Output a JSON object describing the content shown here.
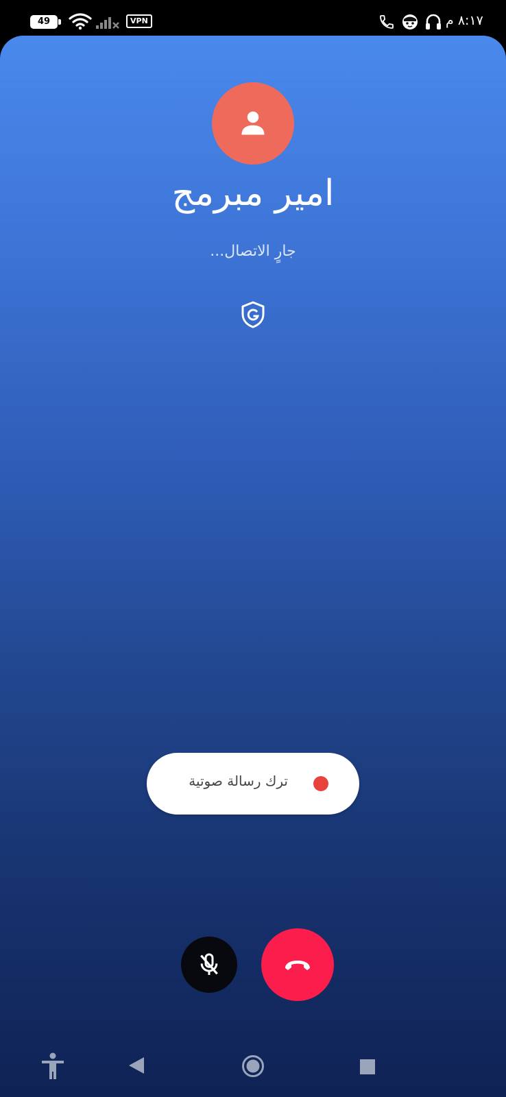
{
  "status_bar": {
    "battery_level": "49",
    "vpn_label": "VPN",
    "clock": "٨:١٧ م",
    "icons": [
      "battery-icon",
      "wifi-icon",
      "signal-icon",
      "vpn-badge",
      "phone-call-icon",
      "face-icon",
      "headset-icon"
    ]
  },
  "call": {
    "caller_name": "امير مبرمج",
    "status": "جارٍ الاتصال...",
    "avatar_color": "#ee6b5c",
    "icons": [
      "person-icon",
      "google-shield-icon"
    ]
  },
  "actions": {
    "voicemail_label": "ترك رسالة صوتية",
    "voicemail_dot_color": "#e8423c",
    "mute_icon": "mic-off-icon",
    "hangup_icon": "call-end-icon",
    "hangup_color": "#fb1d4c"
  },
  "nav_bar": {
    "icons": [
      "accessibility-icon",
      "back-icon",
      "home-icon",
      "recents-icon"
    ]
  }
}
